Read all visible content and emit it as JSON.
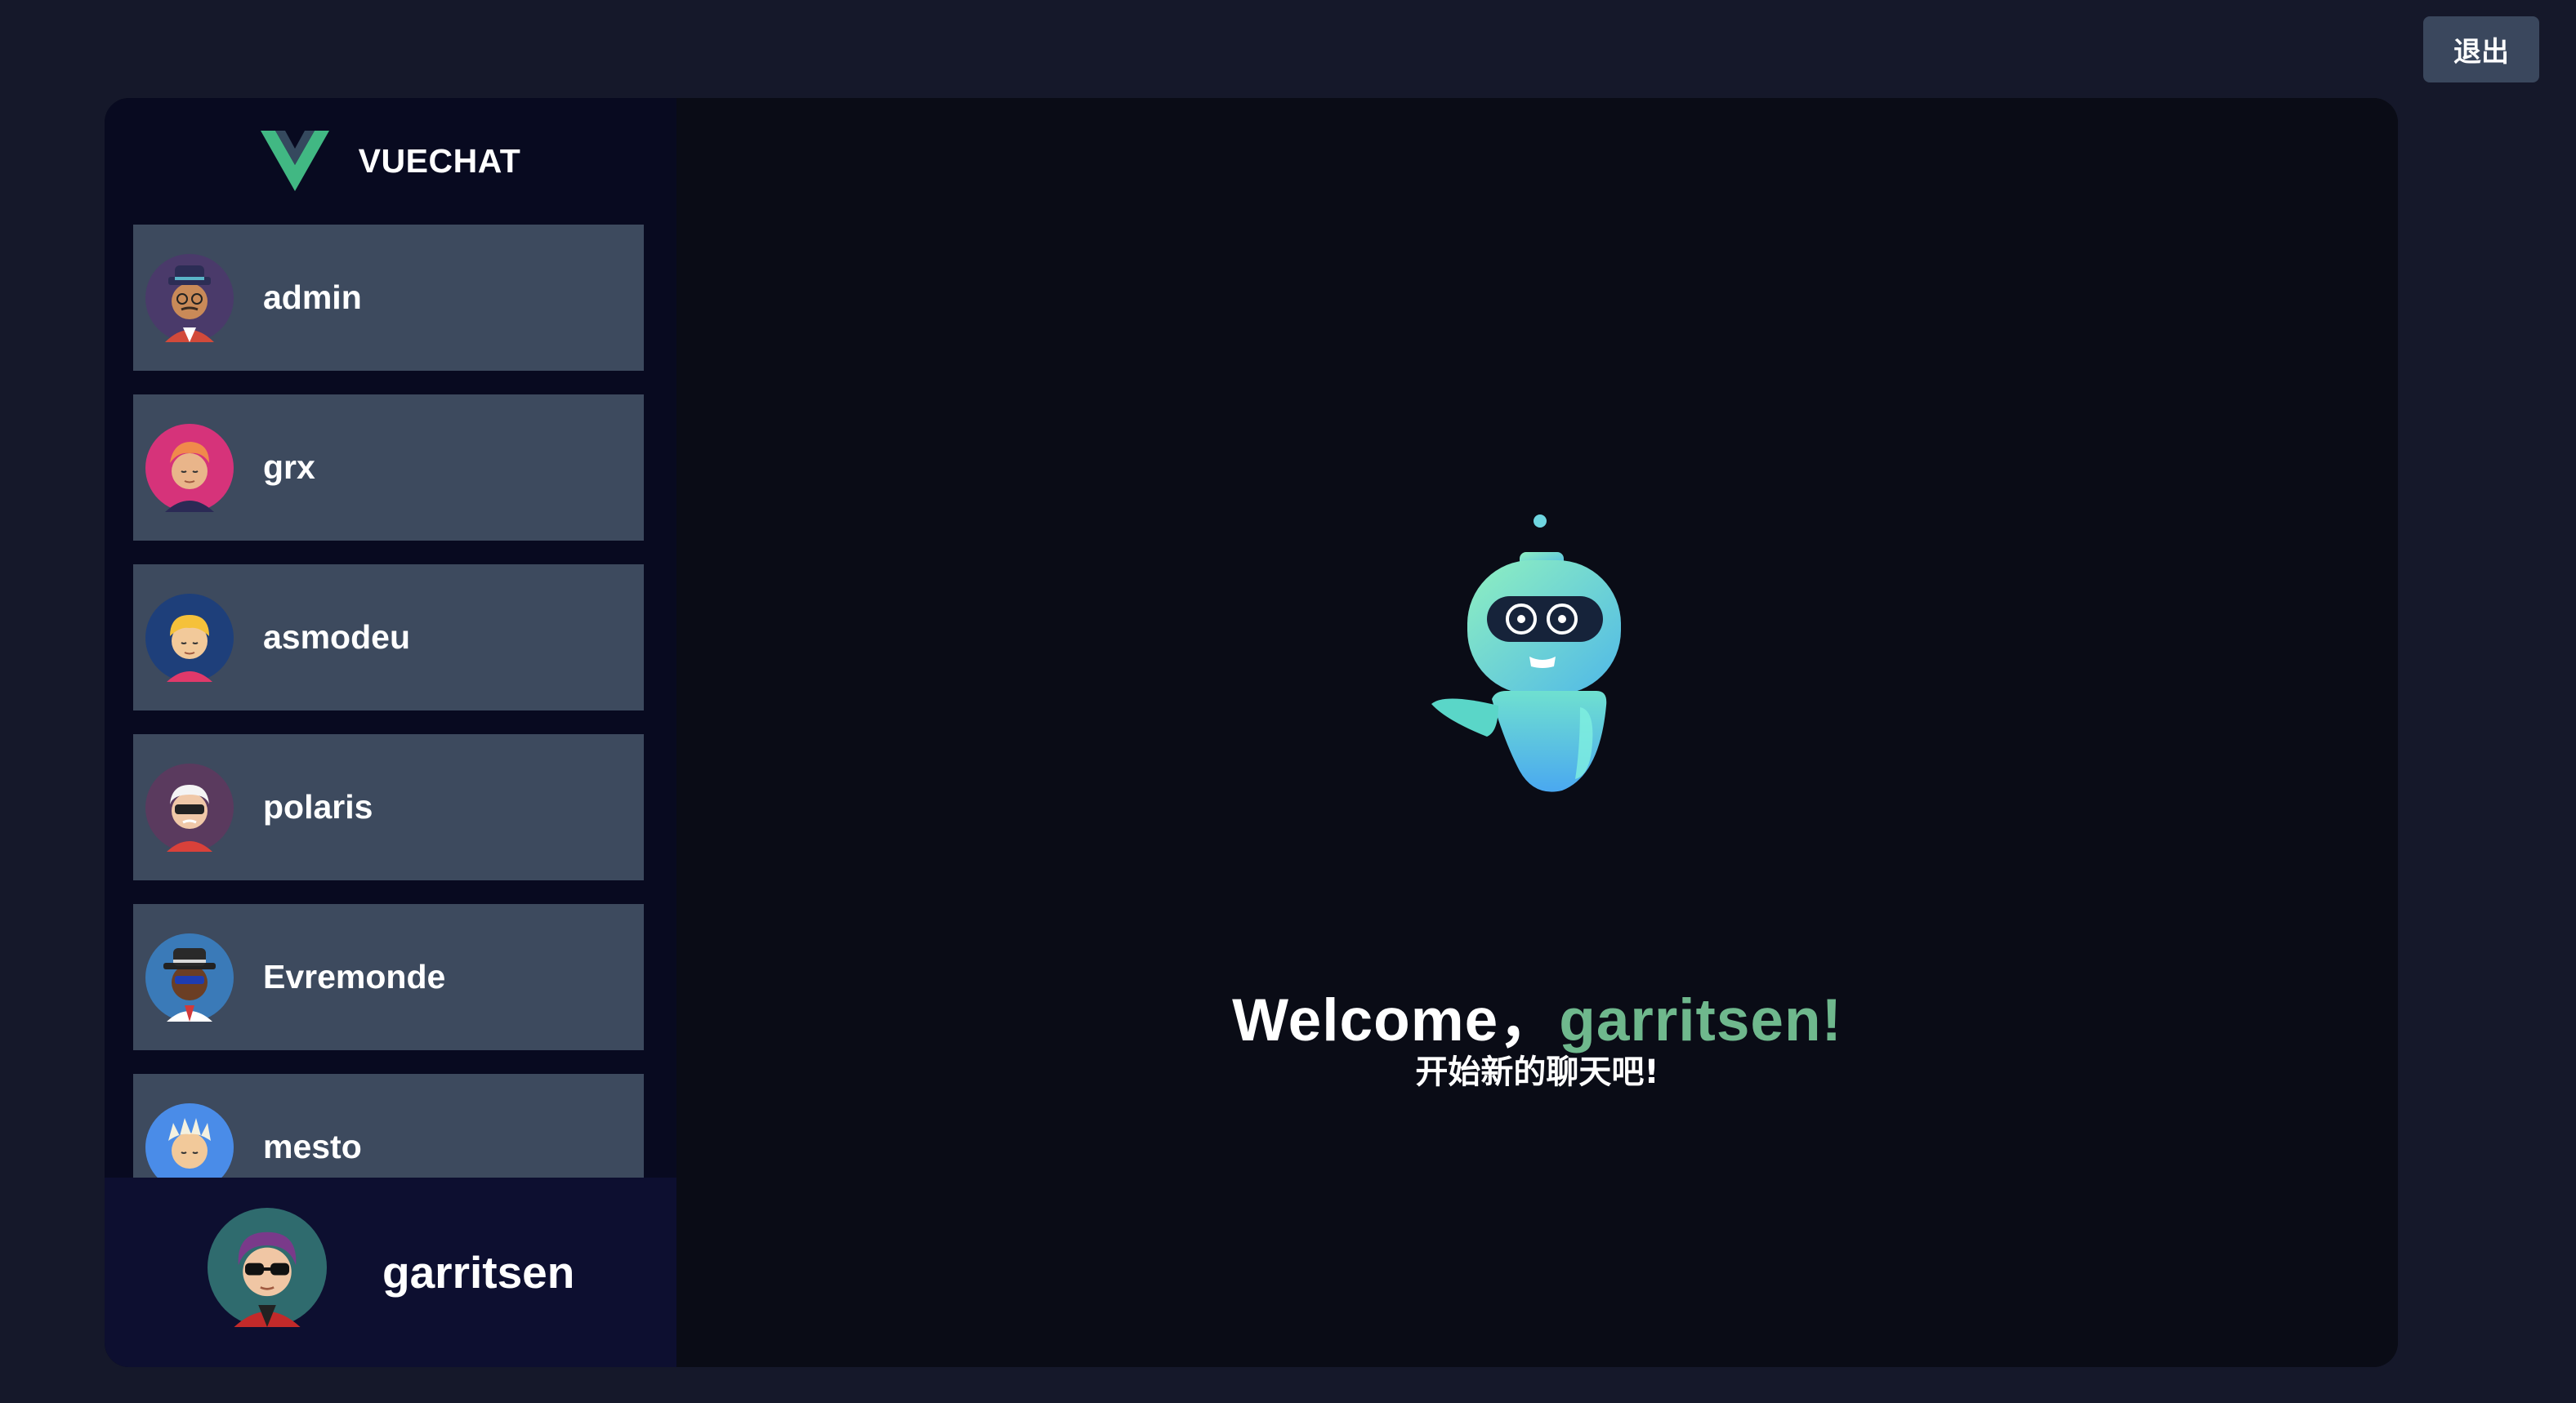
{
  "header": {
    "logout_label": "退出"
  },
  "app": {
    "brand": "VUECHAT"
  },
  "contacts": [
    {
      "name": "admin"
    },
    {
      "name": "grx"
    },
    {
      "name": "asmodeu"
    },
    {
      "name": "polaris"
    },
    {
      "name": "Evremonde"
    },
    {
      "name": "mesto"
    }
  ],
  "current_user": {
    "name": "garritsen"
  },
  "welcome": {
    "greeting": "Welcome，",
    "username": "garritsen!",
    "subtitle": "开始新的聊天吧!"
  },
  "colors": {
    "accent": "#6fb88d",
    "card": "#3d4a5e",
    "sidebar": "#080a20",
    "background": "#15182a"
  },
  "icons": [
    "vue-logo-icon",
    "robot-illustration"
  ]
}
